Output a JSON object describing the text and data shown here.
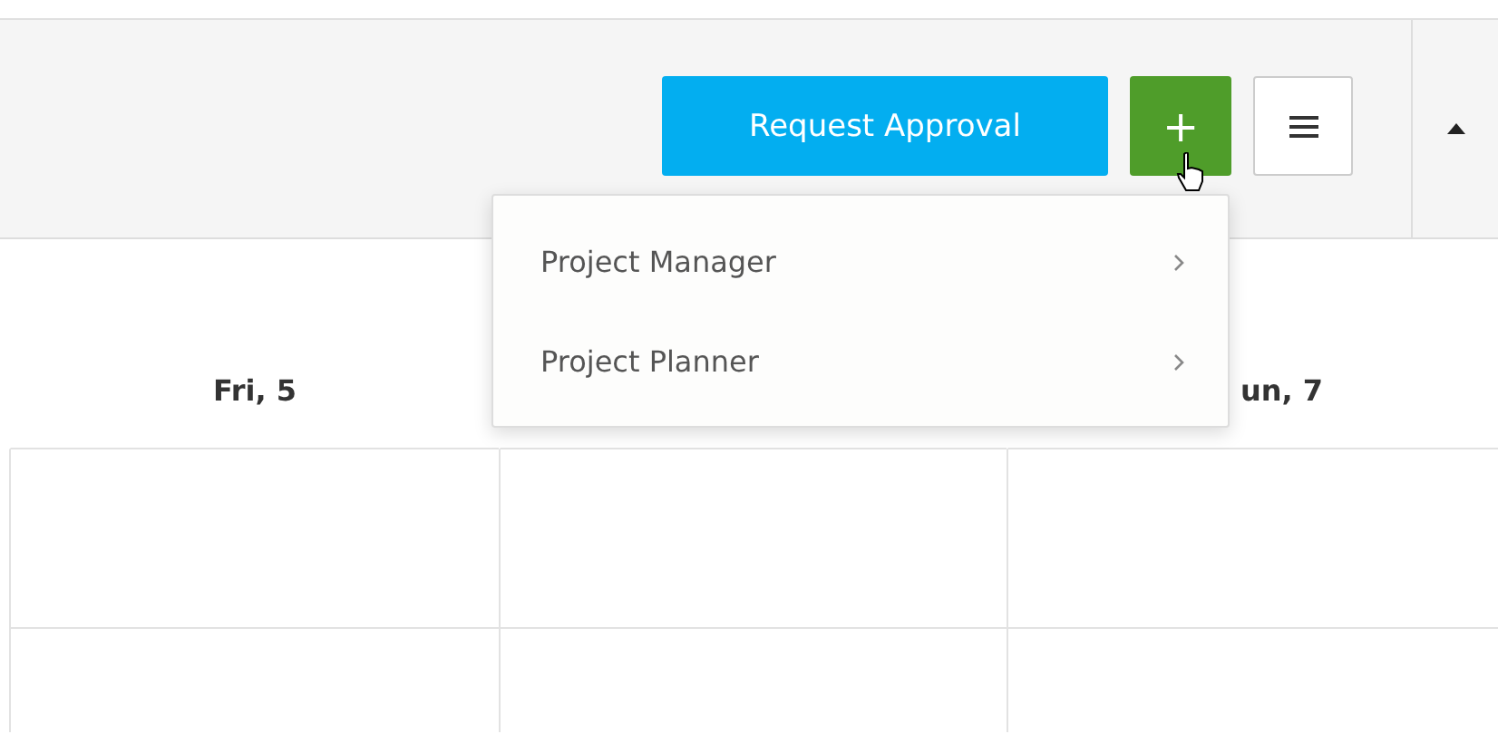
{
  "toolbar": {
    "buttons": [
      {
        "kind": "primary",
        "label": "Request Approval"
      },
      {
        "kind": "add",
        "label": "+"
      },
      {
        "kind": "menu"
      }
    ],
    "collapse": {
      "kind": "up"
    }
  },
  "calendar": {
    "columns": [
      {
        "label": "Fri, 5"
      },
      {},
      {
        "label": "un, 7"
      }
    ]
  },
  "dropdown": {
    "items": [
      {
        "label": "Project Manager",
        "has_submenu": true
      },
      {
        "label": "Project Planner",
        "has_submenu": true
      }
    ]
  }
}
